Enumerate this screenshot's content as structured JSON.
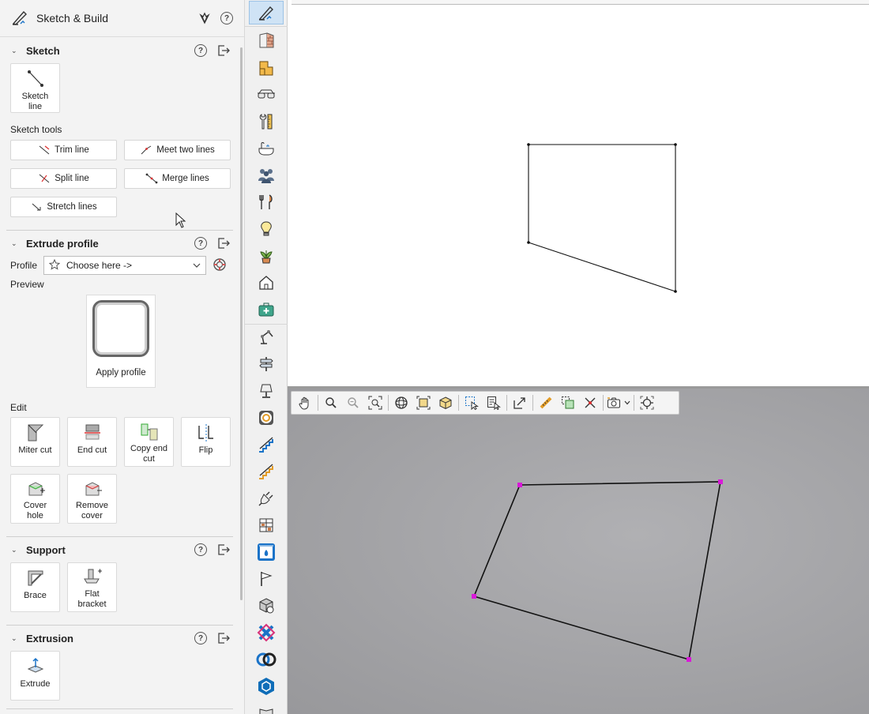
{
  "panel": {
    "title": "Sketch & Build",
    "sections": {
      "sketch": {
        "title": "Sketch",
        "tile": "Sketch line",
        "tools_label": "Sketch tools",
        "tools": {
          "trim": "Trim line",
          "meet": "Meet two lines",
          "split": "Split line",
          "merge": "Merge lines",
          "stretch": "Stretch lines"
        }
      },
      "extrude_profile": {
        "title": "Extrude profile",
        "profile_label": "Profile",
        "profile_value": "Choose here ->",
        "preview_label": "Preview",
        "apply_label": "Apply profile",
        "edit_label": "Edit",
        "edit_tiles": {
          "miter": "Miter cut",
          "end": "End cut",
          "copy_end": "Copy end cut",
          "flip": "Flip",
          "cover": "Cover hole",
          "remove": "Remove cover"
        }
      },
      "support": {
        "title": "Support",
        "brace": "Brace",
        "flat": "Flat bracket"
      },
      "extrusion": {
        "title": "Extrusion",
        "extrude": "Extrude"
      }
    }
  },
  "icons": {
    "header": [
      "sketch-build-icon",
      "tulip-icon",
      "help-icon"
    ],
    "strip": [
      "sketch-icon",
      "wall-icon",
      "floorplan-icon",
      "glasses-icon",
      "tools-icon",
      "bathtub-icon",
      "people-icon",
      "kitchen-utensils-icon",
      "lightbulb-icon",
      "plant-icon",
      "home-icon",
      "first-aid-icon",
      "robot-arm-icon",
      "signpost-icon",
      "lamp-icon",
      "roundabout-icon",
      "stairs-icon",
      "ramp-icon",
      "plug-icon",
      "shelving-icon",
      "fireplace-icon",
      "flag-icon",
      "cube-cog-icon",
      "brand-logo-icon",
      "rings-icon",
      "sketchup-icon",
      "book-icon"
    ],
    "view_toolbar": [
      "pan-icon",
      "zoom-icon",
      "zoom-out-icon",
      "zoom-fit-icon",
      "orbit-icon",
      "front-view-icon",
      "iso-view-icon",
      "select-area-icon",
      "select-text-icon",
      "resize-icon",
      "measure-icon",
      "copy-icon",
      "delete-point-icon",
      "camera-icon",
      "dropdown-caret-icon",
      "crosshair-icon"
    ]
  },
  "colors": {
    "accent": "#1a73c8",
    "vertex_3d": "#d81ad8",
    "active_strip": "#cfe3f5"
  }
}
